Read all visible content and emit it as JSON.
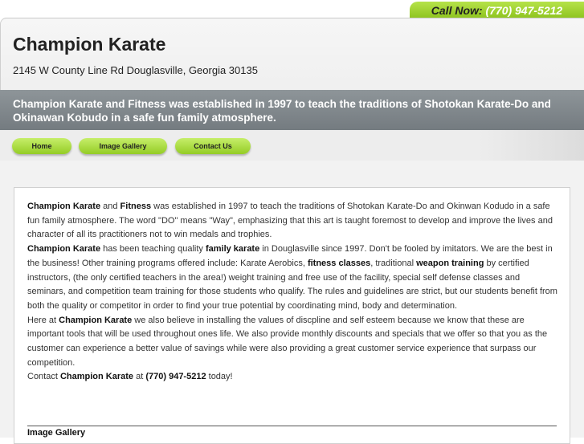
{
  "header": {
    "call_now_label": "Call Now:",
    "phone": "(770) 947-5212",
    "site_title": "Champion Karate",
    "address": "2145 W County Line Rd Douglasville, Georgia 30135",
    "tagline": "Champion Karate and Fitness was established in 1997 to teach the traditions of Shotokan Karate-Do and Okinawan Kobudo in a safe fun family atmosphere."
  },
  "nav": {
    "items": [
      {
        "label": "Home"
      },
      {
        "label": "Image Gallery"
      },
      {
        "label": "Contact Us"
      }
    ]
  },
  "content": {
    "p1": {
      "bold_name": "Champion Karate",
      "and": " and ",
      "bold_fitness": "Fitness",
      "rest": " was established in 1997 to teach the traditions of Shotokan Karate-Do and Okinwan Kodudo in a safe fun family atmosphere. The word \"DO\" means \"Way\", emphasizing that this art is taught foremost to develop and improve the lives and character of all its practitioners not to win medals and trophies."
    },
    "p2": {
      "bold_name": "Champion Karate",
      "t1": " has been teaching quality ",
      "bold_family": "family karate",
      "t2": " in Douglasville since 1997. Don't be fooled by imitators. We are the best in the business! Other training programs offered include: Karate Aerobics, ",
      "bold_fitness_classes": "fitness classes",
      "t3": ", traditional ",
      "bold_weapon": "weapon training",
      "t4": " by certified instructors, (the only certified teachers in the area!) weight training and free use of the facility, special self defense classes and seminars, and competition team training for those students who qualify. The rules and guidelines are strict, but our students benefit from both the quality or competitor in order to find your true potential by coordinating mind, body and determination."
    },
    "p3": {
      "t1": "Here at ",
      "bold_name": "Champion Karate",
      "t2": " we also believe in installing the values of discpline and self esteem because we know that these are important tools that will be used throughout ones life. We also provide monthly discounts and specials that we offer so that you as the customer can experience a better value of savings while were also providing a great customer service experience that surpass our competition."
    },
    "p4": {
      "t1": "Contact ",
      "bold_name": "Champion Karate",
      "t2": " at ",
      "bold_phone": "(770) 947-5212",
      "t3": " today!"
    },
    "gallery_heading": "Image Gallery"
  },
  "colors": {
    "accent_green": "#9ed12f",
    "tagline_bar": "#7f868b"
  }
}
